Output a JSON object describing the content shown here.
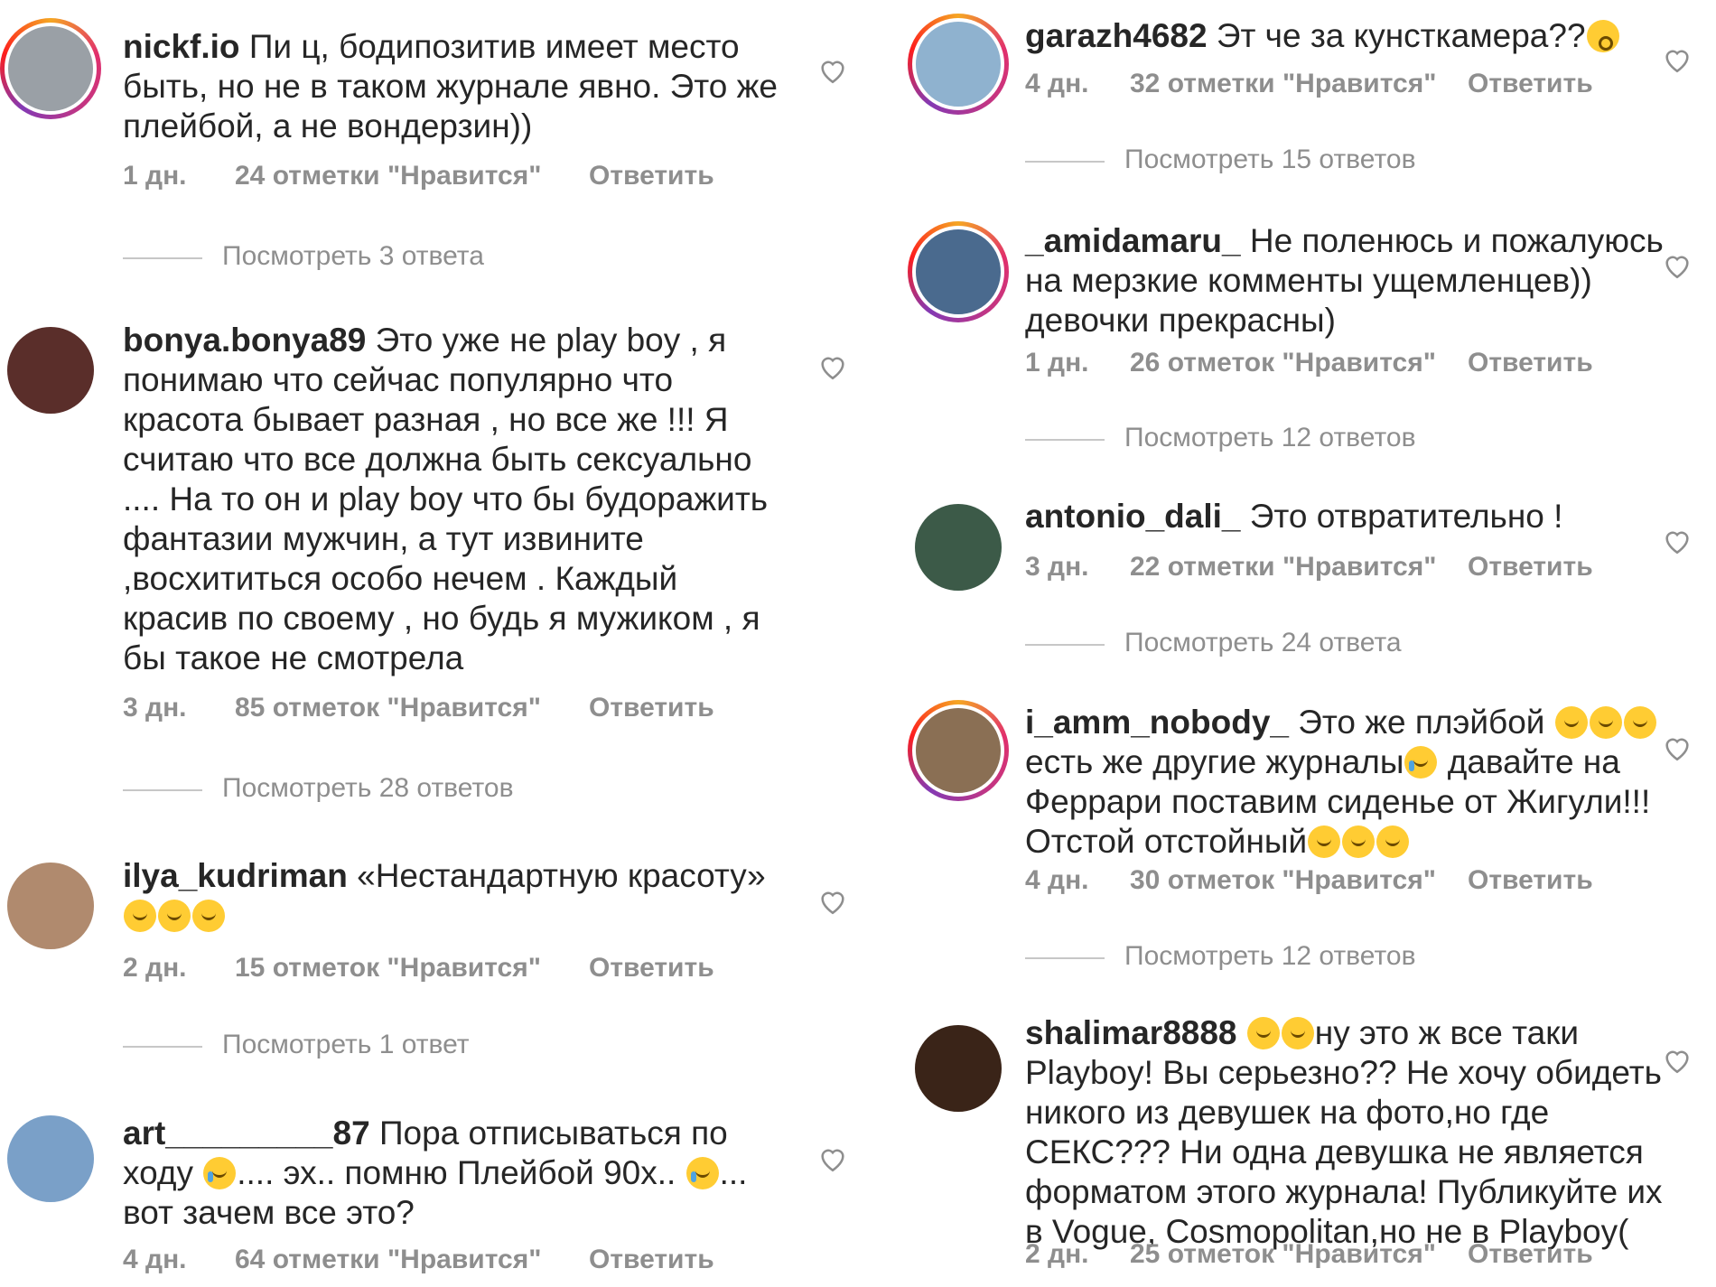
{
  "common": {
    "reply_label": "Ответить"
  },
  "left": [
    {
      "user": "nickf.io",
      "text": "Пи        ц, бодипозитив имеет место быть, но не в таком журнале явно. Это же плейбой, а не вондерзин))",
      "age": "1 дн.",
      "likes": "24 отметки \"Нравится\"",
      "replies": "Посмотреть 3 ответа"
    },
    {
      "user": "bonya.bonya89",
      "text": "Это уже не play boy , я понимаю что сейчас популярно что красота бывает разная , но все же !!! Я считаю что все должна быть сексуально .... На то он и play boy что бы будоражить фантазии мужчин, а тут извините ,восхититься особо нечем . Каждый красив по своему , но будь я мужиком , я бы такое не смотрела",
      "age": "3 дн.",
      "likes": "85 отметок \"Нравится\"",
      "replies": "Посмотреть 28 ответов"
    },
    {
      "user": "ilya_kudriman",
      "text": "«Нестандартную красоту»",
      "age": "2 дн.",
      "likes": "15 отметок \"Нравится\"",
      "replies": "Посмотреть 1 ответ"
    },
    {
      "user": "art_________87",
      "text_a": "Пора отписываться по ходу",
      "text_b": ".... эх.. помню Плейбой 90х..",
      "text_c": "... вот зачем все это?",
      "age": "4 дн.",
      "likes": "64 отметки \"Нравится\""
    }
  ],
  "right": [
    {
      "user": "garazh4682",
      "text": "Эт че за кунсткамера??",
      "age": "4 дн.",
      "likes": "32 отметки \"Нравится\"",
      "replies": "Посмотреть 15 ответов"
    },
    {
      "user": "_amidamaru_",
      "text": "Не поленюсь и пожалуюсь на мерзкие комменты ущемленцев)) девочки прекрасны)",
      "age": "1 дн.",
      "likes": "26 отметок \"Нравится\"",
      "replies": "Посмотреть 12 ответов"
    },
    {
      "user": "antonio_dali_",
      "text": "Это отвратительно !",
      "age": "3 дн.",
      "likes": "22 отметки \"Нравится\"",
      "replies": "Посмотреть 24 ответа"
    },
    {
      "user": "i_amm_nobody_",
      "text_a": "Это же плэйбой",
      "text_b": "есть же другие журналы",
      "text_c": "давайте на Феррари поставим сиденье от Жигули!!! Отстой отстойный",
      "age": "4 дн.",
      "likes": "30 отметок \"Нравится\"",
      "replies": "Посмотреть 12 ответов"
    },
    {
      "user": "shalimar8888",
      "text": "ну это ж все таки Playboy! Вы серьезно?? Не хочу обидеть никого из девушек на фото,но где СЕКС??? Ни одна девушка не является форматом этого журнала! Публикуйте их в Vogue, Cosmopolitan,но не в Playboy(",
      "age": "2 дн.",
      "likes": "25 отметок \"Нравится\""
    }
  ]
}
